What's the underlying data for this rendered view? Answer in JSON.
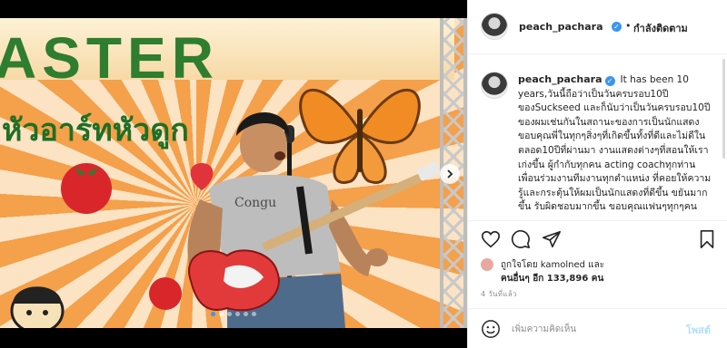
{
  "media": {
    "sign_text": "ASTER",
    "thai_banner_text": "หัวอาร์ทหัวดูก",
    "carousel": {
      "total": 6,
      "active": 0
    }
  },
  "header": {
    "username": "peach_pachara",
    "verified_icon": "✓",
    "separator": "•",
    "follow_status": "กำลังติดตาม"
  },
  "caption": {
    "username": "peach_pachara",
    "verified_icon": "✓",
    "text": "It has been 10 years,วันนี้ถือว่าเป็นวันครบรอบ10ปีของSuckseed และก็นับว่าเป็นวันครบรอบ10ปีของผมเช่นกันในสถานะของการเป็นนักแสดง ขอบคุณพี่ในทุกๆสิ่งๆที่เกิดขึ้นทั้งที่ดีและไม่ดีในตลอด10ปีที่ผ่านมา งานแสดงต่างๆที่สอนให้เราเก่งขึ้น ผู้กำกับทุกคน acting coachทุกท่าน เพื่อนร่วมงานทีมงานทุกตำแหน่ง ที่คอยให้ความรู้และกระตุ้นให้ผมเป็นนักแสดงที่ดีขึ้น ขยันมากขึ้น รับผิดชอบมากขึ้น ขอบคุณแฟนๆทุกๆคน"
  },
  "likes": {
    "line1": "ถูกใจโดย kamolned และ",
    "line2": "คนอื่นๆ อีก 133,896 คน"
  },
  "timestamp": "4 วันที่แล้ว",
  "comment": {
    "placeholder": "เพิ่มความคิดเห็น",
    "post_label": "โพสต์"
  },
  "colors": {
    "accent": "#3897f0",
    "post_disabled": "#b2dffc",
    "muted": "#8e8e8e"
  }
}
